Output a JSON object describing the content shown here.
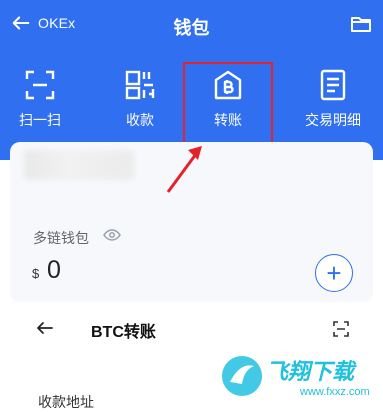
{
  "nav": {
    "back_label": "OKEx",
    "title": "钱包"
  },
  "actions": [
    {
      "label": "扫一扫",
      "icon": "scan-icon"
    },
    {
      "label": "收款",
      "icon": "qr-receive-icon"
    },
    {
      "label": "转账",
      "icon": "bitcoin-transfer-icon"
    },
    {
      "label": "交易明细",
      "icon": "document-list-icon"
    }
  ],
  "wallet": {
    "chain_label": "多链钱包",
    "currency_symbol": "$",
    "balance": "0"
  },
  "transfer": {
    "title": "BTC转账",
    "receive_label": "收款地址"
  },
  "watermark": {
    "title": "飞翔下载",
    "url": "www.fxxz.com"
  },
  "colors": {
    "brand_blue": "#2f6ff0",
    "highlight_red": "#e3232c",
    "watermark_cyan": "#20c0e0"
  }
}
